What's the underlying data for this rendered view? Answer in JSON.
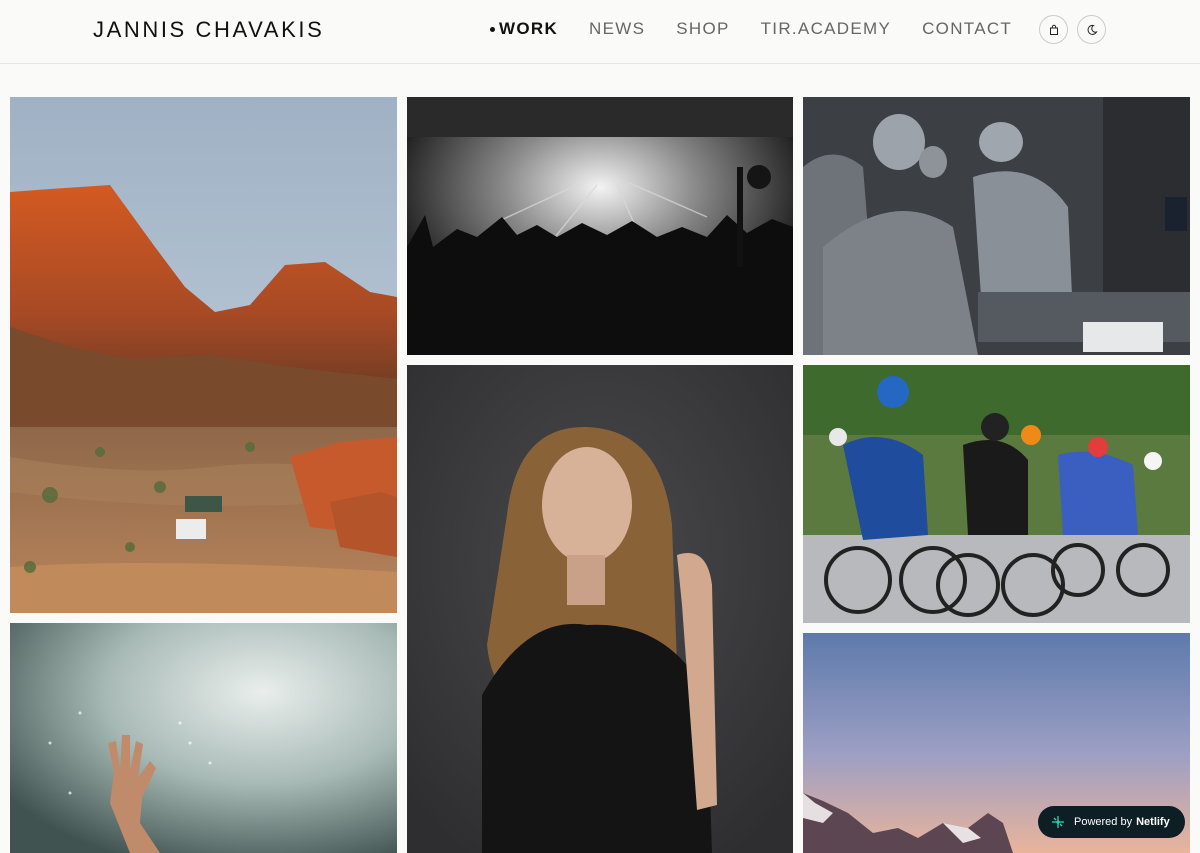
{
  "site": {
    "logo": "JANNIS CHAVAKIS"
  },
  "nav": {
    "items": [
      {
        "label": "WORK",
        "active": true
      },
      {
        "label": "NEWS",
        "active": false
      },
      {
        "label": "SHOP",
        "active": false
      },
      {
        "label": "TIR.ACADEMY",
        "active": false
      },
      {
        "label": "CONTACT",
        "active": false
      }
    ],
    "cart_icon": "shopping-bag-icon",
    "theme_icon": "moon-icon"
  },
  "gallery": {
    "tiles": [
      {
        "name": "desert-mountains-camp-photo"
      },
      {
        "name": "concert-crowd-photo"
      },
      {
        "name": "surgeons-operating-room-photo"
      },
      {
        "name": "woman-portrait-photo"
      },
      {
        "name": "cycling-race-photo"
      },
      {
        "name": "raised-hand-smoke-photo"
      },
      {
        "name": "mountain-sunset-photo"
      }
    ]
  },
  "badge": {
    "prefix": "Powered by",
    "brand": "Netlify",
    "icon": "netlify-icon"
  },
  "colors": {
    "background": "#fafaf8",
    "text": "#111111",
    "nav_inactive": "#666666",
    "badge_bg": "#0e1e25",
    "netlify_accent": "#2fcfb4"
  }
}
